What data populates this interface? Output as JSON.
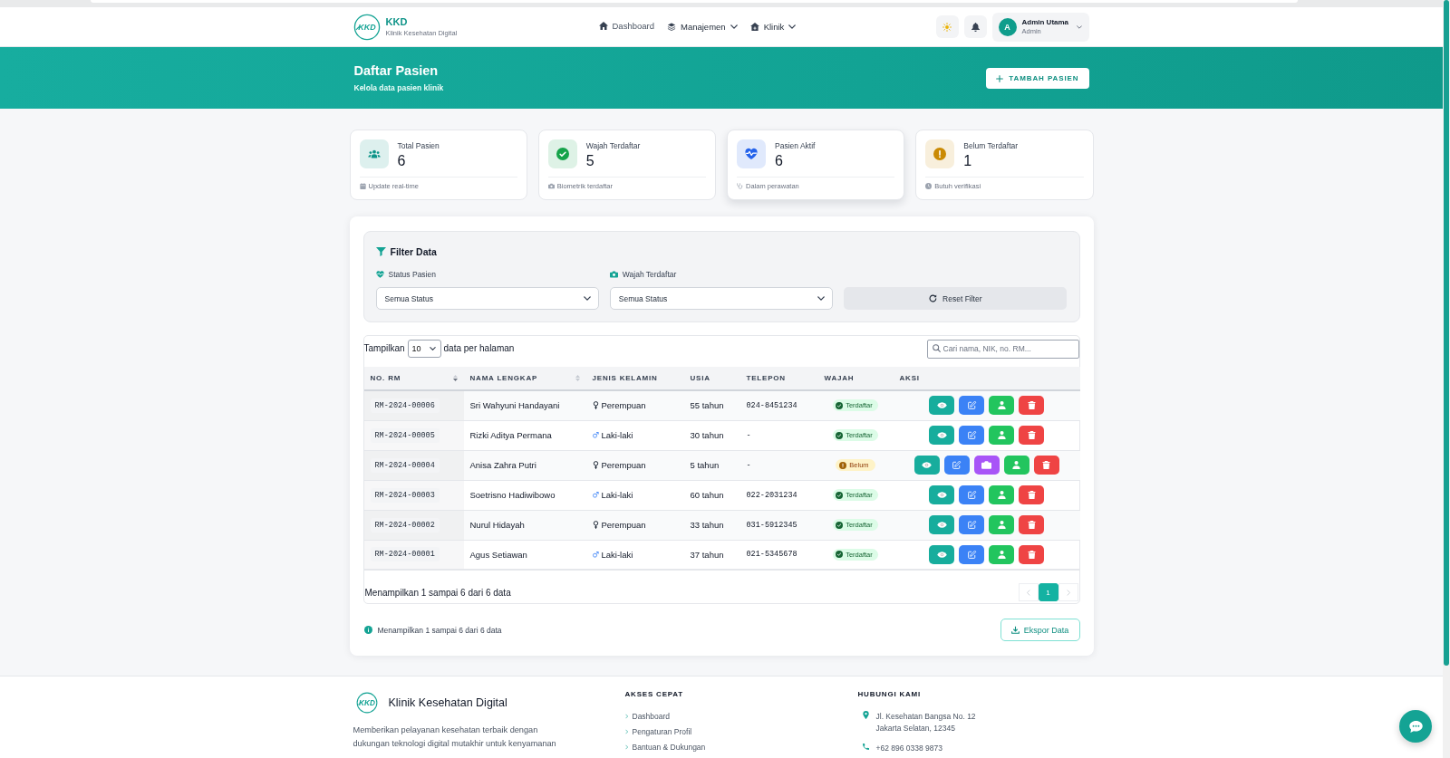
{
  "navbar": {
    "logo_mark": "KKD",
    "brand": "KKD",
    "tagline": "Klinik Kesehatan Digital",
    "menu": [
      {
        "label": "Dashboard",
        "kind": "home",
        "has_menu": false
      },
      {
        "label": "Manajemen",
        "kind": "layers",
        "has_menu": true
      },
      {
        "label": "Klinik",
        "kind": "clinic",
        "has_menu": true
      }
    ],
    "user": {
      "initial": "A",
      "name": "Admin Utama",
      "role": "Admin"
    }
  },
  "hero": {
    "title": "Daftar Pasien",
    "subtitle": "Kelola data pasien klinik",
    "action": {
      "label": "TAMBAH PASIEN"
    }
  },
  "stats": [
    {
      "kind": "users",
      "color": "#0d9488",
      "label": "Total Pasien",
      "value": "6",
      "note": "Update real-time",
      "highlighted": false
    },
    {
      "kind": "check",
      "color": "#16a34a",
      "label": "Wajah Terdaftar",
      "value": "5",
      "note": "Biometrik terdaftar",
      "highlighted": false
    },
    {
      "kind": "heart",
      "color": "#2563eb",
      "label": "Pasien Aktif",
      "value": "6",
      "note": "Dalam perawatan",
      "highlighted": true
    },
    {
      "kind": "alert",
      "color": "#ca8a04",
      "label": "Belum Terdaftar",
      "value": "1",
      "note": "Butuh verifikasi",
      "highlighted": false
    }
  ],
  "filter": {
    "title": "Filter Data",
    "fields": [
      {
        "kind": "heart",
        "label": "Status Pasien",
        "value": "Semua Status"
      },
      {
        "kind": "camera",
        "label": "Wajah Terdaftar",
        "value": "Semua Status"
      }
    ],
    "reset": {
      "label": "Reset Filter"
    }
  },
  "table": {
    "length": {
      "before": "Tampilkan",
      "value": "10",
      "after": "data per halaman"
    },
    "search": {
      "placeholder": "Cari nama, NIK, no. RM..."
    },
    "columns": [
      {
        "label": "NO. RM",
        "sortable": true,
        "sorted": true
      },
      {
        "label": "NAMA LENGKAP",
        "sortable": true,
        "sorted": false
      },
      {
        "label": "JENIS KELAMIN",
        "sortable": false,
        "sorted": false
      },
      {
        "label": "USIA",
        "sortable": false,
        "sorted": false
      },
      {
        "label": "TELEPON",
        "sortable": false,
        "sorted": false
      },
      {
        "label": "WAJAH",
        "sortable": false,
        "sorted": false
      },
      {
        "label": "AKSI",
        "sortable": false,
        "sorted": false
      }
    ],
    "rows": [
      {
        "rm": "RM-2024-00006",
        "name": "Sri Wahyuni Handayani",
        "gender": {
          "kind": "female",
          "label": "Perempuan"
        },
        "age": "55 tahun",
        "phone": "024-8451234",
        "face": {
          "kind": "registered",
          "label": "Terdaftar"
        },
        "actions": [
          {
            "kind": "view"
          },
          {
            "kind": "edit"
          },
          {
            "kind": "profile"
          },
          {
            "kind": "delete"
          }
        ]
      },
      {
        "rm": "RM-2024-00005",
        "name": "Rizki Aditya Permana",
        "gender": {
          "kind": "male",
          "label": "Laki-laki"
        },
        "age": "30 tahun",
        "phone": "-",
        "face": {
          "kind": "registered",
          "label": "Terdaftar"
        },
        "actions": [
          {
            "kind": "view"
          },
          {
            "kind": "edit"
          },
          {
            "kind": "profile"
          },
          {
            "kind": "delete"
          }
        ]
      },
      {
        "rm": "RM-2024-00004",
        "name": "Anisa Zahra Putri",
        "gender": {
          "kind": "female",
          "label": "Perempuan"
        },
        "age": "5 tahun",
        "phone": "-",
        "face": {
          "kind": "pending",
          "label": "Belum"
        },
        "actions": [
          {
            "kind": "view"
          },
          {
            "kind": "edit"
          },
          {
            "kind": "camera"
          },
          {
            "kind": "profile"
          },
          {
            "kind": "delete"
          }
        ]
      },
      {
        "rm": "RM-2024-00003",
        "name": "Soetrisno Hadiwibowo",
        "gender": {
          "kind": "male",
          "label": "Laki-laki"
        },
        "age": "60 tahun",
        "phone": "022-2031234",
        "face": {
          "kind": "registered",
          "label": "Terdaftar"
        },
        "actions": [
          {
            "kind": "view"
          },
          {
            "kind": "edit"
          },
          {
            "kind": "profile"
          },
          {
            "kind": "delete"
          }
        ]
      },
      {
        "rm": "RM-2024-00002",
        "name": "Nurul Hidayah",
        "gender": {
          "kind": "female",
          "label": "Perempuan"
        },
        "age": "33 tahun",
        "phone": "031-5912345",
        "face": {
          "kind": "registered",
          "label": "Terdaftar"
        },
        "actions": [
          {
            "kind": "view"
          },
          {
            "kind": "edit"
          },
          {
            "kind": "profile"
          },
          {
            "kind": "delete"
          }
        ]
      },
      {
        "rm": "RM-2024-00001",
        "name": "Agus Setiawan",
        "gender": {
          "kind": "male",
          "label": "Laki-laki"
        },
        "age": "37 tahun",
        "phone": "021-5345678",
        "face": {
          "kind": "registered",
          "label": "Terdaftar"
        },
        "actions": [
          {
            "kind": "view"
          },
          {
            "kind": "edit"
          },
          {
            "kind": "profile"
          },
          {
            "kind": "delete"
          }
        ]
      }
    ],
    "info": "Menampilkan 1 sampai 6 dari 6 data",
    "pagination": {
      "prev": {
        "disabled": true
      },
      "pages": [
        {
          "label": "1",
          "selected": true
        }
      ],
      "next": {
        "disabled": true
      }
    }
  },
  "summary": {
    "text": "Menampilkan 1 sampai 6 dari 6 data",
    "export": {
      "label": "Ekspor Data"
    }
  },
  "footer": {
    "logo_mark": "KKD",
    "name": "Klinik Kesehatan Digital",
    "description": "Memberikan pelayanan kesehatan terbaik dengan dukungan teknologi digital mutakhir untuk kenyamanan",
    "quick_links": {
      "title": "AKSES CEPAT",
      "items": [
        "Dashboard",
        "Pengaturan Profil",
        "Bantuan & Dukungan"
      ]
    },
    "contact": {
      "title": "HUBUNGI KAMI",
      "items": [
        {
          "kind": "location",
          "lines": [
            "Jl. Kesehatan Bangsa No. 12",
            "Jakarta Selatan, 12345"
          ]
        },
        {
          "kind": "phone",
          "lines": [
            "+62 896 0338 9873"
          ]
        }
      ]
    }
  }
}
